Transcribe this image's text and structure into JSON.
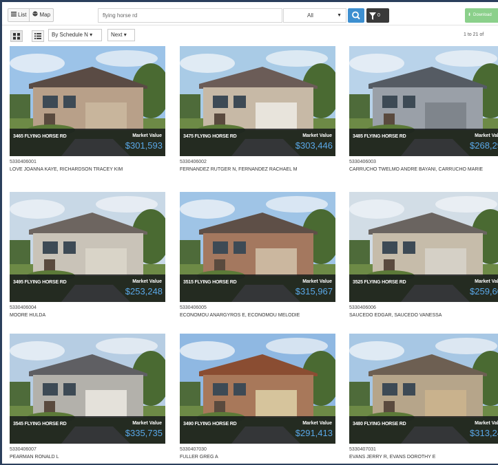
{
  "toolbar": {
    "list_label": "List",
    "map_label": "Map",
    "search_value": "flying horse rd",
    "filter_select": "All",
    "filter_count": "0",
    "download_label": "Download"
  },
  "subbar": {
    "sort_label": "By Schedule N",
    "order_label": "Next",
    "page_count": "1 to 21 of"
  },
  "colors": {
    "accent_blue": "#3d8fd0",
    "value_blue": "#5aa8e8",
    "download_green": "#8bd08b",
    "frame": "#2b3f5c"
  },
  "listings": [
    {
      "address": "3465 FLYING HORSE RD",
      "value_label": "Market Value",
      "value": "$301,593",
      "parcel_id": "5330406001",
      "owner": "LOVE JOANNA KAYE, RICHARDSON TRACEY KIM"
    },
    {
      "address": "3475 FLYING HORSE RD",
      "value_label": "Market Value",
      "value": "$303,446",
      "parcel_id": "5330406002",
      "owner": "FERNANDEZ RUTGER N, FERNANDEZ RACHAEL M"
    },
    {
      "address": "3485 FLYING HORSE RD",
      "value_label": "Market Valu",
      "value": "$268,29",
      "parcel_id": "5330406003",
      "owner": "CARRUCHO TWELMO ANDRE BAYANI, CARRUCHO MARIE"
    },
    {
      "address": "3495 FLYING HORSE RD",
      "value_label": "Market Value",
      "value": "$253,248",
      "parcel_id": "5330406004",
      "owner": "MOORE HULDA"
    },
    {
      "address": "3515 FLYING HORSE RD",
      "value_label": "Market Value",
      "value": "$315,967",
      "parcel_id": "5330406005",
      "owner": "ECONOMOU ANARGYROS E, ECONOMOU MELODIE"
    },
    {
      "address": "3525 FLYING HORSE RD",
      "value_label": "Market Valu",
      "value": "$259,60",
      "parcel_id": "5330406006",
      "owner": "SAUCEDO EDGAR, SAUCEDO VANESSA"
    },
    {
      "address": "3545 FLYING HORSE RD",
      "value_label": "Market Value",
      "value": "$335,735",
      "parcel_id": "5330406007",
      "owner": "PEARMAN RONALD L"
    },
    {
      "address": "3490 FLYING HORSE RD",
      "value_label": "Market Value",
      "value": "$291,413",
      "parcel_id": "5330407030",
      "owner": "FULLER GREG A"
    },
    {
      "address": "3480 FLYING HORSE RD",
      "value_label": "Market Valu",
      "value": "$313,24",
      "parcel_id": "5330407031",
      "owner": "EVANS JERRY R, EVANS DOROTHY E"
    }
  ]
}
